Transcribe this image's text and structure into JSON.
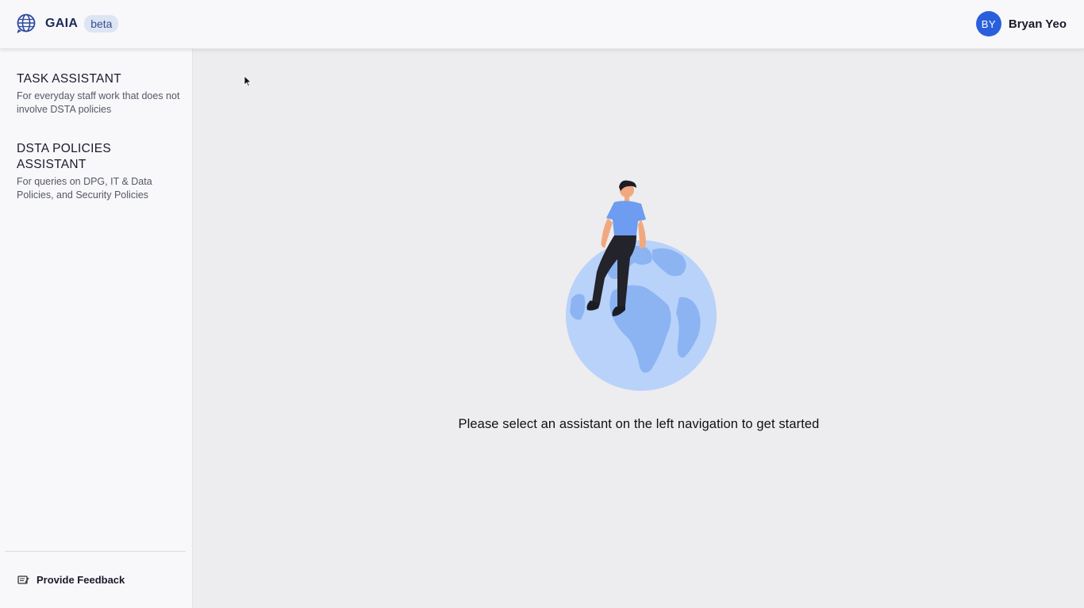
{
  "header": {
    "brand_icon": "globe-chat-icon",
    "app_name": "GAIA",
    "badge": "beta",
    "user": {
      "initials": "BY",
      "name": "Bryan Yeo"
    }
  },
  "sidebar": {
    "items": [
      {
        "title": "TASK ASSISTANT",
        "description": "For everyday staff work that does not involve DSTA policies"
      },
      {
        "title": "DSTA POLICIES ASSISTANT",
        "description": "For queries on DPG, IT & Data Policies, and Security Policies"
      }
    ],
    "feedback": {
      "icon": "feedback-icon",
      "label": "Provide Feedback"
    }
  },
  "main": {
    "illustration": "person-sitting-on-globe",
    "prompt": "Please select an assistant on the left navigation to get started"
  },
  "colors": {
    "accent": "#2a5fdc",
    "brand_text": "#1d2a5c",
    "badge_bg": "#dde5f5",
    "globe_light": "#b9d2f9",
    "globe_dark": "#8cb4f3",
    "shirt": "#6d9cf0"
  }
}
